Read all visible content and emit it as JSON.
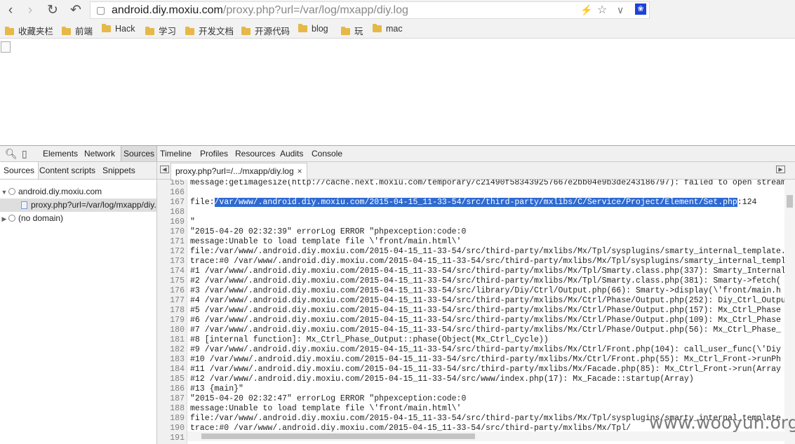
{
  "address_bar": {
    "url_host": "android.diy.moxiu.com",
    "url_path": "/proxy.php?url=/var/log/mxapp/diy.log"
  },
  "icons": {
    "back": "back-arrow-icon",
    "forward": "forward-arrow-icon",
    "reload": "reload-icon",
    "undo": "undo-icon",
    "page_info": "page-info-icon",
    "lightning": "lightning-icon",
    "star": "star-icon",
    "chevron": "chevron-down-icon",
    "extension": "paw-extension-icon"
  },
  "bookmarks": [
    "收藏夹栏",
    "前端",
    "Hack",
    "学习",
    "开发文档",
    "开源代码",
    "blog",
    "玩",
    "mac"
  ],
  "devtools": {
    "tabs": [
      "Elements",
      "Network",
      "Sources",
      "Timeline",
      "Profiles",
      "Resources",
      "Audits",
      "Console"
    ],
    "active_tab": "Sources",
    "navigator_tabs": [
      "Sources",
      "Content scripts",
      "Snippets"
    ],
    "tree": [
      {
        "label": "android.diy.moxiu.com",
        "expanded": true
      },
      {
        "label": "proxy.php?url=/var/log/mxapp/diy.log",
        "selected": true
      },
      {
        "label": "(no domain)",
        "expanded": false
      }
    ],
    "file_tab": "proxy.php?url=/.../mxapp/diy.log",
    "file_tab_close": "×"
  },
  "editor": {
    "lines": [
      {
        "n": "165",
        "t": "message:getimagesize(http://cache.next.moxiu.com/temporary/c21490f583439257667e2bb04e9b3de243186797): failed to open stream"
      },
      {
        "n": "166",
        "t": ""
      },
      {
        "n": "167",
        "pre": "file:",
        "hl": "/var/www/.android.diy.moxiu.com/2015-04-15_11-33-54/src/third-party/mxlibs/C/Service/Project/Element/Set.php",
        "post": ":124"
      },
      {
        "n": "168",
        "t": ""
      },
      {
        "n": "169",
        "t": "\""
      },
      {
        "n": "170",
        "t": "\"2015-04-20 02:32:39\" errorLog ERROR \"phpexception:code:0"
      },
      {
        "n": "171",
        "t": "message:Unable to load template file \\'front/main.html\\'"
      },
      {
        "n": "172",
        "t": "file:/var/www/.android.diy.moxiu.com/2015-04-15_11-33-54/src/third-party/mxlibs/Mx/Tpl/sysplugins/smarty_internal_template.php"
      },
      {
        "n": "173",
        "t": "trace:#0 /var/www/.android.diy.moxiu.com/2015-04-15_11-33-54/src/third-party/mxlibs/Mx/Tpl/sysplugins/smarty_internal_template"
      },
      {
        "n": "174",
        "t": "#1 /var/www/.android.diy.moxiu.com/2015-04-15_11-33-54/src/third-party/mxlibs/Mx/Tpl/Smarty.class.php(337): Smarty_Internal"
      },
      {
        "n": "175",
        "t": "#2 /var/www/.android.diy.moxiu.com/2015-04-15_11-33-54/src/third-party/mxlibs/Mx/Tpl/Smarty.class.php(381): Smarty->fetch("
      },
      {
        "n": "176",
        "t": "#3 /var/www/.android.diy.moxiu.com/2015-04-15_11-33-54/src/library/Diy/Ctrl/Output.php(66): Smarty->display(\\'front/main.h"
      },
      {
        "n": "177",
        "t": "#4 /var/www/.android.diy.moxiu.com/2015-04-15_11-33-54/src/third-party/mxlibs/Mx/Ctrl/Phase/Output.php(252): Diy_Ctrl_Output"
      },
      {
        "n": "178",
        "t": "#5 /var/www/.android.diy.moxiu.com/2015-04-15_11-33-54/src/third-party/mxlibs/Mx/Ctrl/Phase/Output.php(157): Mx_Ctrl_Phase"
      },
      {
        "n": "179",
        "t": "#6 /var/www/.android.diy.moxiu.com/2015-04-15_11-33-54/src/third-party/mxlibs/Mx/Ctrl/Phase/Output.php(109): Mx_Ctrl_Phase"
      },
      {
        "n": "180",
        "t": "#7 /var/www/.android.diy.moxiu.com/2015-04-15_11-33-54/src/third-party/mxlibs/Mx/Ctrl/Phase/Output.php(56): Mx_Ctrl_Phase_"
      },
      {
        "n": "181",
        "t": "#8 [internal function]: Mx_Ctrl_Phase_Output::phase(Object(Mx_Ctrl_Cycle))"
      },
      {
        "n": "182",
        "t": "#9 /var/www/.android.diy.moxiu.com/2015-04-15_11-33-54/src/third-party/mxlibs/Mx/Ctrl/Front.php(104): call_user_func(\\'Diy"
      },
      {
        "n": "183",
        "t": "#10 /var/www/.android.diy.moxiu.com/2015-04-15_11-33-54/src/third-party/mxlibs/Mx/Ctrl/Front.php(55): Mx_Ctrl_Front->runPh"
      },
      {
        "n": "184",
        "t": "#11 /var/www/.android.diy.moxiu.com/2015-04-15_11-33-54/src/third-party/mxlibs/Mx/Facade.php(85): Mx_Ctrl_Front->run(Array"
      },
      {
        "n": "185",
        "t": "#12 /var/www/.android.diy.moxiu.com/2015-04-15_11-33-54/src/www/index.php(17): Mx_Facade::startup(Array)"
      },
      {
        "n": "186",
        "t": "#13 {main}\""
      },
      {
        "n": "187",
        "t": "\"2015-04-20 02:32:47\" errorLog ERROR \"phpexception:code:0"
      },
      {
        "n": "188",
        "t": "message:Unable to load template file \\'front/main.html\\'"
      },
      {
        "n": "189",
        "t": "file:/var/www/.android.diy.moxiu.com/2015-04-15_11-33-54/src/third-party/mxlibs/Mx/Tpl/sysplugins/smarty_internal_template"
      },
      {
        "n": "190",
        "t": "trace:#0 /var/www/.android.diy.moxiu.com/2015-04-15_11-33-54/src/third-party/mxlibs/Mx/Tpl/"
      },
      {
        "n": "191",
        "t": ""
      }
    ]
  },
  "watermark": "www.wooyun.org"
}
